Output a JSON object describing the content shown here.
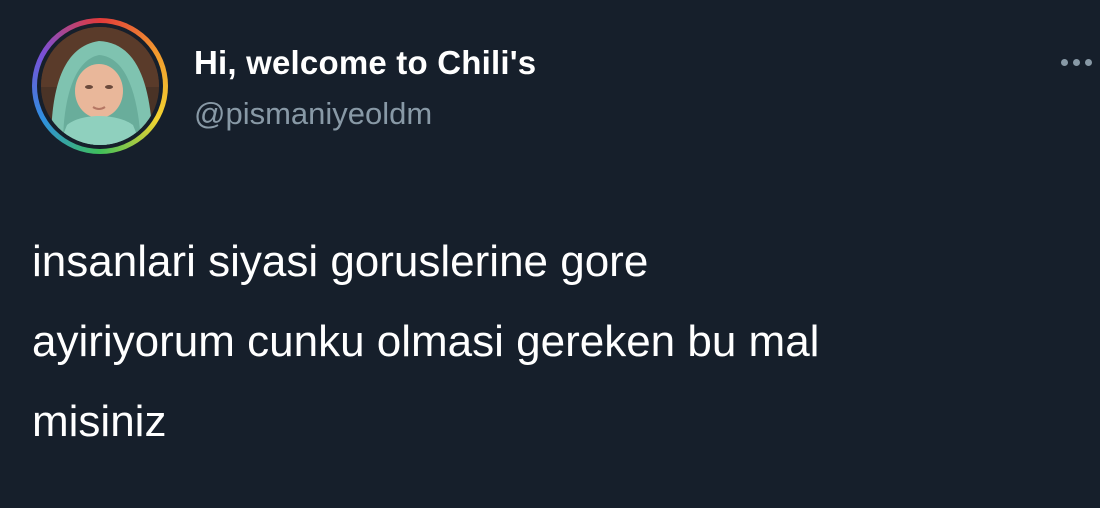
{
  "tweet": {
    "author": {
      "display_name": "Hi, welcome to Chili's",
      "handle": "@pismaniyeoldm"
    },
    "text_lines": [
      "insanlari siyasi goruslerine gore",
      "ayiriyorum cunku olmasi gereken bu mal",
      "misiniz"
    ],
    "icons": {
      "more": "more-dots-icon",
      "avatar_ring": "rainbow-ring"
    }
  }
}
